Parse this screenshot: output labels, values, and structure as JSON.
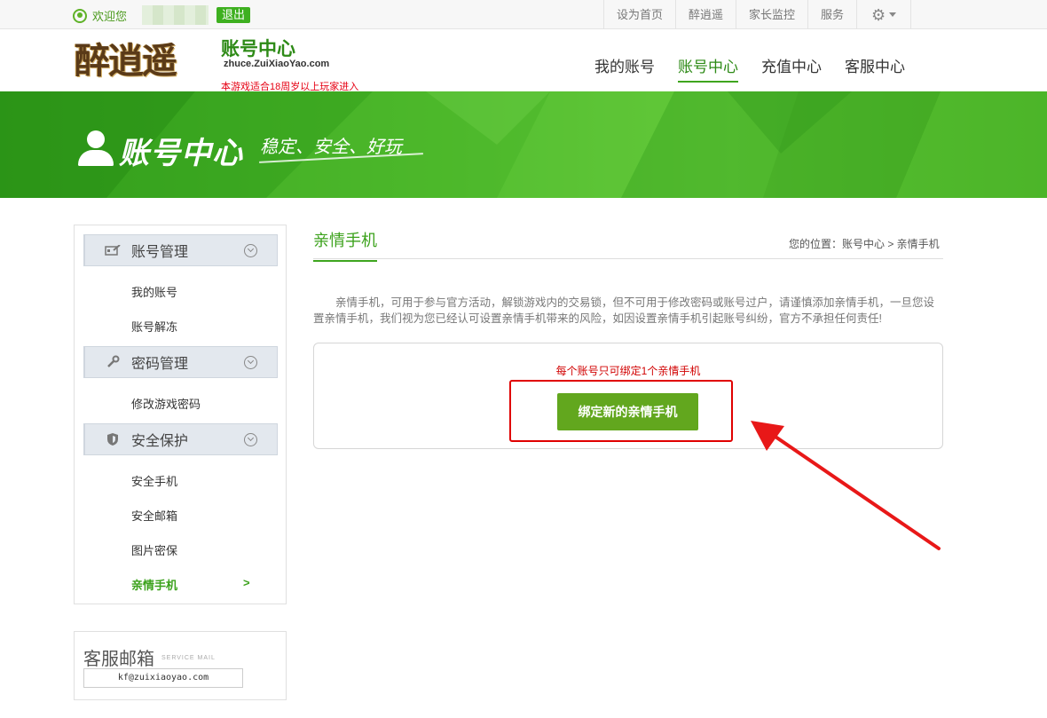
{
  "topbar": {
    "welcome": "欢迎您",
    "logout": "退出",
    "links": [
      "设为首页",
      "醉逍遥",
      "家长监控",
      "服务"
    ],
    "settings_icon": "gear-icon"
  },
  "header": {
    "logo_text": "醉逍遥",
    "site_title": "账号中心",
    "domain": "zhuce.ZuiXiaoYao.com",
    "age_note": "本游戏适合18周岁以上玩家进入",
    "nav": [
      {
        "label": "我的账号",
        "active": false
      },
      {
        "label": "账号中心",
        "active": true
      },
      {
        "label": "充值中心",
        "active": false
      },
      {
        "label": "客服中心",
        "active": false
      }
    ]
  },
  "banner": {
    "title": "账号中心",
    "slogan": "稳定、安全、好玩"
  },
  "sidebar": {
    "sections": [
      {
        "label": "账号管理",
        "icon": "id-card-icon",
        "items": [
          "我的账号",
          "账号解冻"
        ]
      },
      {
        "label": "密码管理",
        "icon": "wrench-icon",
        "items": [
          "修改游戏密码"
        ]
      },
      {
        "label": "安全保护",
        "icon": "shield-icon",
        "items": [
          "安全手机",
          "安全邮箱",
          "图片密保",
          "亲情手机"
        ]
      }
    ],
    "active_item": "亲情手机",
    "active_marker": ">"
  },
  "service_mail": {
    "title": "客服邮箱",
    "subtitle": "SERVICE MAIL",
    "email": "kf@zuixiaoyao.com"
  },
  "main": {
    "title": "亲情手机",
    "breadcrumb": "您的位置：账号中心 > 亲情手机",
    "notice": "亲情手机，可用于参与官方活动，解锁游戏内的交易锁，但不可用于修改密码或账号过户，请谨慎添加亲情手机，一旦您设置亲情手机，我们视为您已经认可设置亲情手机带来的风险，如因设置亲情手机引起账号纠纷，官方不承担任何责任!",
    "bind_hint": "每个账号只可绑定1个亲情手机",
    "bind_button": "绑定新的亲情手机"
  },
  "colors": {
    "accent_green": "#3ca21c",
    "button_green": "#62a71e",
    "warning_red": "#d10000",
    "annotation_red": "#e00000"
  }
}
